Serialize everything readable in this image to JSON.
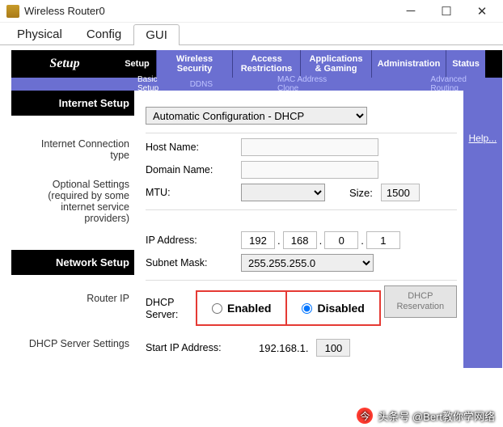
{
  "window": {
    "title": "Wireless Router0"
  },
  "app_tabs": {
    "physical": "Physical",
    "config": "Config",
    "gui": "GUI"
  },
  "nav": {
    "setup_title": "Setup",
    "items": [
      "Setup",
      "Wireless Security",
      "Access Restrictions",
      "Applications & Gaming",
      "Administration",
      "Status"
    ],
    "sub": {
      "basic": "Basic Setup",
      "ddns": "DDNS",
      "mac": "MAC Address Clone",
      "adv": "Advanced Routing"
    }
  },
  "left": {
    "internet_head": "Internet Setup",
    "conn_type": "Internet Connection type",
    "optional": "Optional Settings (required by some internet service providers)",
    "network_head": "Network Setup",
    "router_ip": "Router IP",
    "dhcp_settings": "DHCP Server Settings"
  },
  "form": {
    "conn_select": "Automatic Configuration - DHCP",
    "host_label": "Host Name:",
    "domain_label": "Domain Name:",
    "mtu_label": "MTU:",
    "size_label": "Size:",
    "size_value": "1500",
    "ip_label": "IP Address:",
    "ip": [
      "192",
      "168",
      "0",
      "1"
    ],
    "mask_label": "Subnet Mask:",
    "mask_value": "255.255.255.0",
    "dhcp_label_l1": "DHCP",
    "dhcp_label_l2": "Server:",
    "enabled": "Enabled",
    "disabled": "Disabled",
    "reservation": "DHCP Reservation",
    "start_label": "Start IP Address:",
    "start_prefix": "192.168.1.",
    "start_val": "100"
  },
  "right": {
    "help": "Help..."
  },
  "watermark": "头条号 @Bert教你学网络"
}
